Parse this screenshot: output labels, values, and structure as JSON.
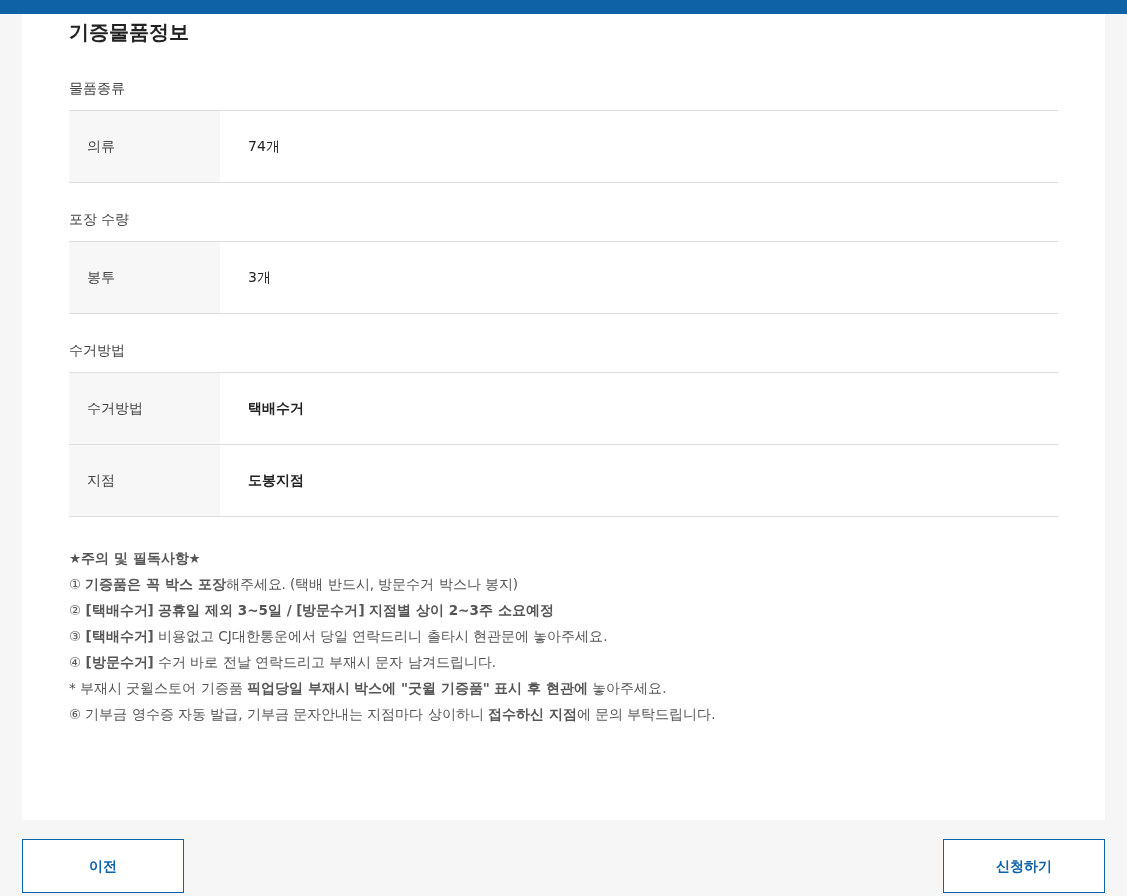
{
  "title": "기증물품정보",
  "sections": [
    {
      "heading": "물품종류",
      "rows": [
        {
          "label": "의류",
          "value": "74개",
          "bold": false
        }
      ]
    },
    {
      "heading": "포장 수량",
      "rows": [
        {
          "label": "봉투",
          "value": "3개",
          "bold": false
        }
      ]
    },
    {
      "heading": "수거방법",
      "rows": [
        {
          "label": "수거방법",
          "value": "택배수거",
          "bold": true
        },
        {
          "label": "지점",
          "value": "도봉지점",
          "bold": true
        }
      ]
    }
  ],
  "notes": [
    "**★주의 및 필독사항★**",
    "① **기증품은 꼭 박스 포장**해주세요. (택배 반드시, 방문수거 박스나 봉지)",
    "② **[택배수거] 공휴일 제외 3~5일 / [방문수거] 지점별 상이 2~3주 소요예정**",
    "③ **[택배수거]** 비용없고 CJ대한통운에서 당일 연락드리니 출타시 현관문에 놓아주세요.",
    "④ **[방문수거]** 수거 바로 전날 연락드리고 부재시 문자 남겨드립니다.",
    "* 부재시 굿윌스토어 기증품 **픽업당일 부재시 박스에 \"굿윌 기증품\" 표시 후 현관에** 놓아주세요.",
    "⑥ 기부금 영수증 자동 발급, 기부금 문자안내는 지점마다 상이하니 **접수하신 지점**에 문의 부탁드립니다."
  ],
  "buttons": {
    "prev": "이전",
    "submit": "신청하기"
  }
}
